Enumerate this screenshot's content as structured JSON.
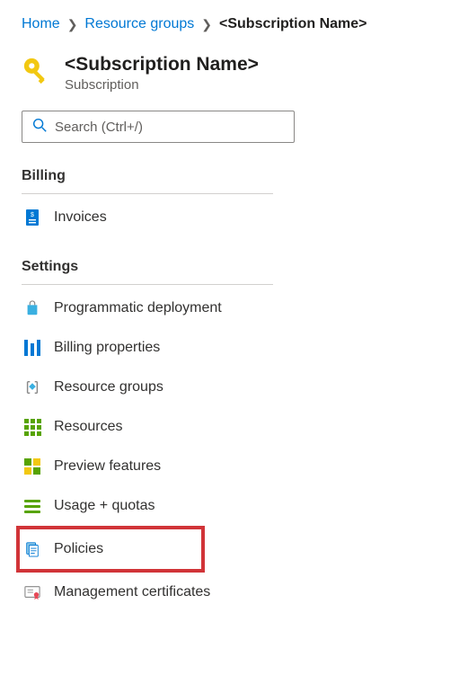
{
  "breadcrumb": {
    "home": "Home",
    "groups": "Resource groups",
    "current": "<Subscription Name>"
  },
  "header": {
    "title": "<Subscription Name>",
    "subtitle": "Subscription"
  },
  "search": {
    "placeholder": "Search (Ctrl+/)"
  },
  "sections": {
    "billing": {
      "title": "Billing",
      "items": {
        "invoices": "Invoices"
      }
    },
    "settings": {
      "title": "Settings",
      "items": {
        "programmatic_deployment": "Programmatic deployment",
        "billing_properties": "Billing properties",
        "resource_groups": "Resource groups",
        "resources": "Resources",
        "preview_features": "Preview features",
        "usage_quotas": "Usage + quotas",
        "policies": "Policies",
        "management_certificates": "Management certificates"
      }
    }
  }
}
